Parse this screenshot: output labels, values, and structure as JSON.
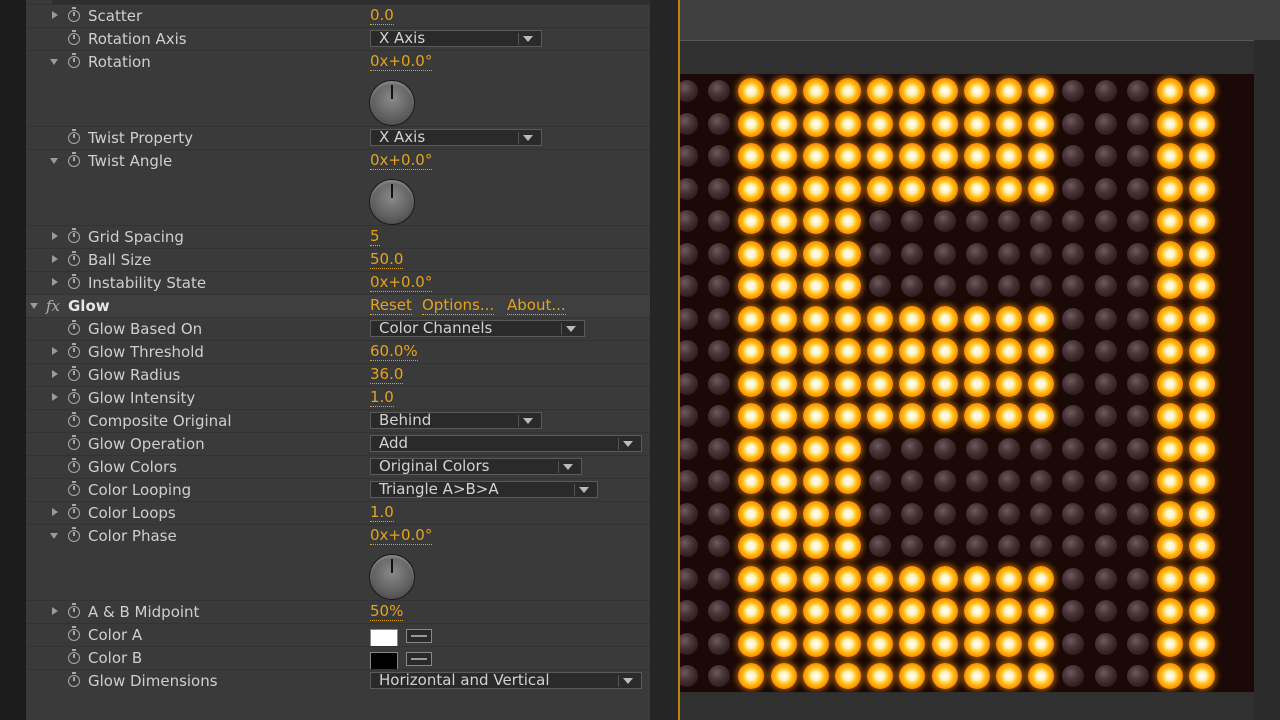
{
  "effect_controls": {
    "properties": [
      {
        "id": "scatter",
        "label": "Scatter",
        "kind": "value",
        "value": "0.0",
        "twirl": "closed"
      },
      {
        "id": "rotation-axis",
        "label": "Rotation Axis",
        "kind": "dropdown",
        "value": "X Axis",
        "twirl": "none"
      },
      {
        "id": "rotation",
        "label": "Rotation",
        "kind": "angle",
        "value": "0x+0.0°",
        "twirl": "open"
      },
      {
        "id": "twist-property",
        "label": "Twist Property",
        "kind": "dropdown",
        "value": "X Axis",
        "twirl": "none"
      },
      {
        "id": "twist-angle",
        "label": "Twist Angle",
        "kind": "angle",
        "value": "0x+0.0°",
        "twirl": "open"
      },
      {
        "id": "grid-spacing",
        "label": "Grid Spacing",
        "kind": "value",
        "value": "5",
        "twirl": "closed"
      },
      {
        "id": "ball-size",
        "label": "Ball Size",
        "kind": "value",
        "value": "50.0",
        "twirl": "closed"
      },
      {
        "id": "instability-state",
        "label": "Instability State",
        "kind": "value",
        "value": "0x+0.0°",
        "twirl": "closed"
      }
    ],
    "glow_effect": {
      "fx_label": "fx",
      "name": "Glow",
      "reset_label": "Reset",
      "options_label": "Options...",
      "about_label": "About..."
    },
    "glow_properties": [
      {
        "id": "glow-based-on",
        "label": "Glow Based On",
        "kind": "dropdown",
        "value": "Color Channels",
        "twirl": "none"
      },
      {
        "id": "glow-threshold",
        "label": "Glow Threshold",
        "kind": "value",
        "value": "60.0%",
        "twirl": "closed"
      },
      {
        "id": "glow-radius",
        "label": "Glow Radius",
        "kind": "value",
        "value": "36.0",
        "twirl": "closed"
      },
      {
        "id": "glow-intensity",
        "label": "Glow Intensity",
        "kind": "value",
        "value": "1.0",
        "twirl": "closed"
      },
      {
        "id": "composite-original",
        "label": "Composite Original",
        "kind": "dropdown",
        "value": "Behind",
        "twirl": "none"
      },
      {
        "id": "glow-operation",
        "label": "Glow Operation",
        "kind": "dropdown",
        "value": "Add",
        "twirl": "none"
      },
      {
        "id": "glow-colors",
        "label": "Glow Colors",
        "kind": "dropdown",
        "value": "Original Colors",
        "twirl": "none"
      },
      {
        "id": "color-looping",
        "label": "Color Looping",
        "kind": "dropdown",
        "value": "Triangle A>B>A",
        "twirl": "none"
      },
      {
        "id": "color-loops",
        "label": "Color Loops",
        "kind": "value",
        "value": "1.0",
        "twirl": "closed"
      },
      {
        "id": "color-phase",
        "label": "Color Phase",
        "kind": "angle",
        "value": "0x+0.0°",
        "twirl": "open"
      },
      {
        "id": "ab-midpoint",
        "label": "A & B Midpoint",
        "kind": "value",
        "value": "50%",
        "twirl": "closed"
      },
      {
        "id": "color-a",
        "label": "Color A",
        "kind": "color",
        "value": "#ffffff",
        "twirl": "none"
      },
      {
        "id": "color-b",
        "label": "Color B",
        "kind": "color",
        "value": "#000000",
        "twirl": "none"
      },
      {
        "id": "glow-dimensions",
        "label": "Glow Dimensions",
        "kind": "dropdown",
        "value": "Horizontal and Vertical",
        "twirl": "none"
      }
    ]
  },
  "colors": {
    "value_accent": "#e3a31d",
    "glow_on": "#ffb000",
    "ball_off": "#4a3538",
    "panel_bg": "#3a3a3a"
  },
  "composition_grid": {
    "rows": [
      "00111111111100011",
      "00111111111100011",
      "00111111111100011",
      "00111111111100011",
      "00111100000000011",
      "00111100000000011",
      "00111100000000011",
      "00111111111100011",
      "00111111111100011",
      "00111111111100011",
      "00111111111100011",
      "00111100000000011",
      "00111100000000011",
      "00111100000000011",
      "00111100000000011",
      "00111111111100011",
      "00111111111100011",
      "00111111111100011",
      "00111111111100011"
    ]
  }
}
